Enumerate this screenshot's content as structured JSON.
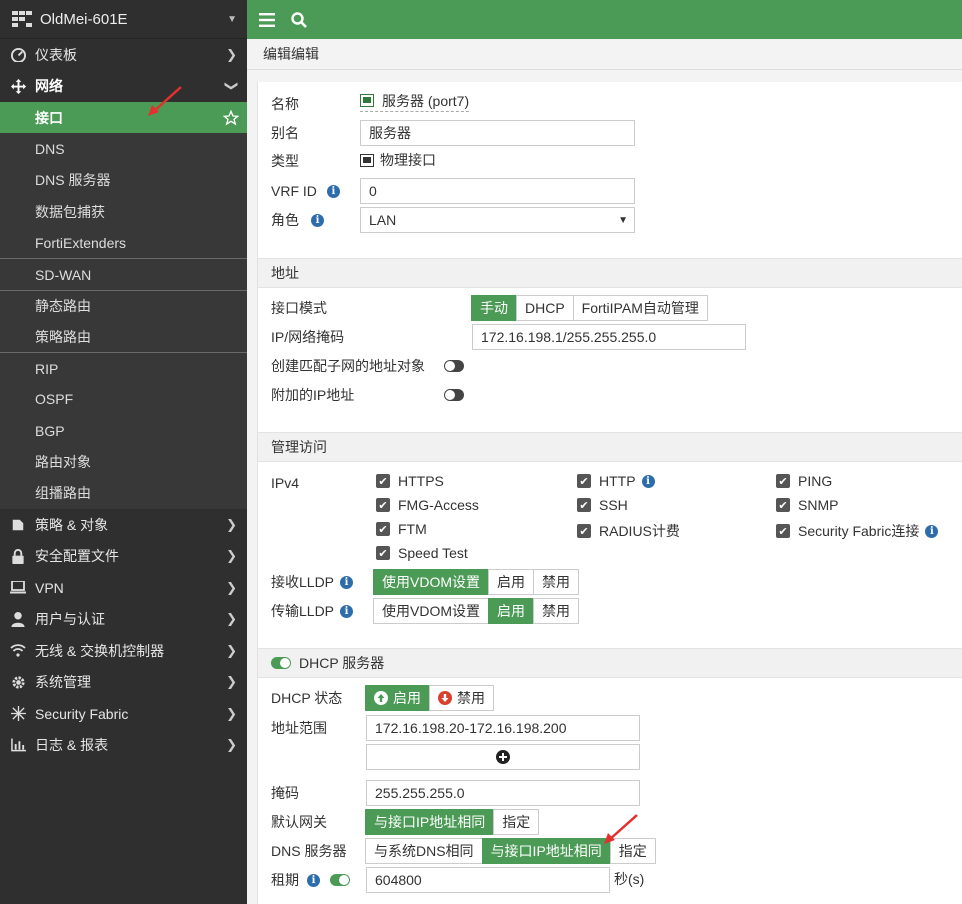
{
  "device": {
    "name": "OldMei-601E"
  },
  "sidebar": {
    "items": [
      {
        "label": "仪表板"
      },
      {
        "label": "网络"
      },
      {
        "label": "策略 & 对象"
      },
      {
        "label": "安全配置文件"
      },
      {
        "label": "VPN"
      },
      {
        "label": "用户与认证"
      },
      {
        "label": "无线 & 交换机控制器"
      },
      {
        "label": "系统管理"
      },
      {
        "label": "Security Fabric"
      },
      {
        "label": "日志 & 报表"
      }
    ],
    "network_sub": [
      {
        "label": "接口"
      },
      {
        "label": "DNS"
      },
      {
        "label": "DNS 服务器"
      },
      {
        "label": "数据包捕获"
      },
      {
        "label": "FortiExtenders"
      },
      {
        "label": "SD-WAN"
      },
      {
        "label": "静态路由"
      },
      {
        "label": "策略路由"
      },
      {
        "label": "RIP"
      },
      {
        "label": "OSPF"
      },
      {
        "label": "BGP"
      },
      {
        "label": "路由对象"
      },
      {
        "label": "组播路由"
      }
    ]
  },
  "page": {
    "title": "编辑编辑"
  },
  "form": {
    "name_label": "名称",
    "name_value": "服务器 (port7)",
    "alias_label": "别名",
    "alias_value": "服务器",
    "type_label": "类型",
    "type_value": "物理接口",
    "vrf_label": "VRF ID",
    "vrf_value": "0",
    "role_label": "角色",
    "role_value": "LAN"
  },
  "address": {
    "section": "地址",
    "mode_label": "接口模式",
    "modes": [
      "手动",
      "DHCP",
      "FortiIPAM自动管理"
    ],
    "ip_label": "IP/网络掩码",
    "ip_value": "172.16.198.1/255.255.255.0",
    "create_label": "创建匹配子网的地址对象",
    "extra_label": "附加的IP地址"
  },
  "admin": {
    "section": "管理访问",
    "ipv4_label": "IPv4",
    "checks": [
      "HTTPS",
      "HTTP",
      "PING",
      "FMG-Access",
      "SSH",
      "SNMP",
      "FTM",
      "RADIUS计费",
      "Security Fabric连接",
      "Speed Test"
    ],
    "lldp_rx_label": "接收LLDP",
    "lldp_tx_label": "传输LLDP",
    "lldp_opts": [
      "使用VDOM设置",
      "启用",
      "禁用"
    ]
  },
  "dhcp": {
    "section": "DHCP 服务器",
    "status_label": "DHCP 状态",
    "enable": "启用",
    "disable": "禁用",
    "range_label": "地址范围",
    "range_value": "172.16.198.20-172.16.198.200",
    "mask_label": "掩码",
    "mask_value": "255.255.255.0",
    "gw_label": "默认网关",
    "gw_opts": [
      "与接口IP地址相同",
      "指定"
    ],
    "dns_label": "DNS 服务器",
    "dns_opts": [
      "与系统DNS相同",
      "与接口IP地址相同",
      "指定"
    ],
    "lease_label": "租期",
    "lease_value": "604800",
    "lease_unit": "秒(s)"
  }
}
